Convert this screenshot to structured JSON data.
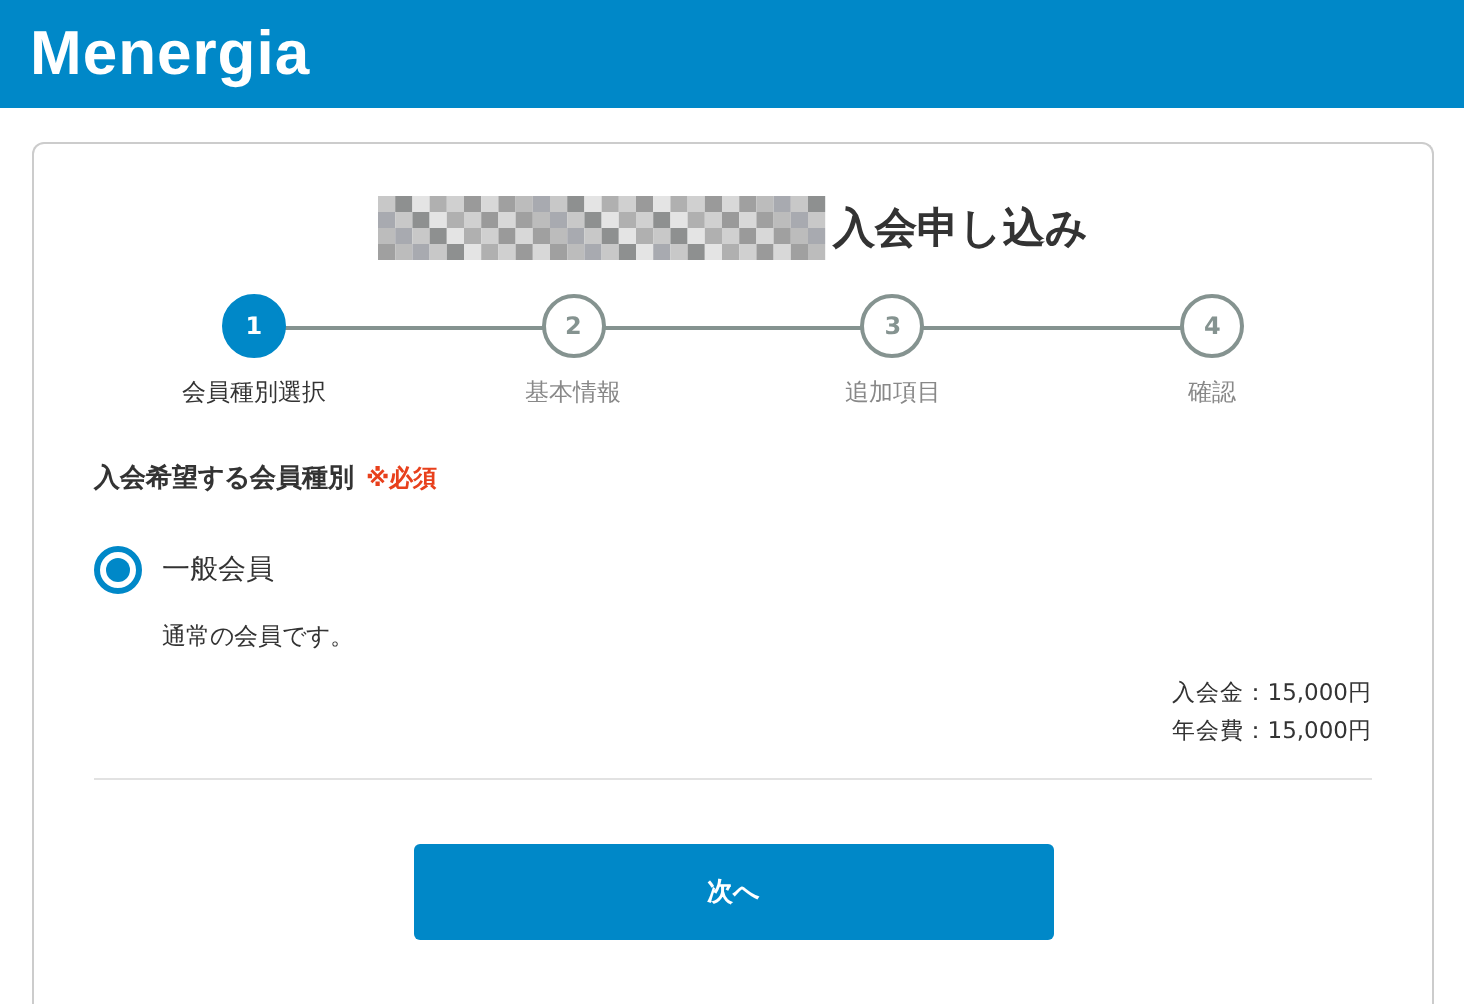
{
  "header": {
    "logo": "Menergia"
  },
  "page_title": "入会申し込み",
  "steps": [
    {
      "number": "1",
      "label": "会員種別選択",
      "selected": true
    },
    {
      "number": "2",
      "label": "基本情報",
      "selected": false
    },
    {
      "number": "3",
      "label": "追加項目",
      "selected": false
    },
    {
      "number": "4",
      "label": "確認",
      "selected": false
    }
  ],
  "field": {
    "label": "入会希望する会員種別",
    "required": "※必須"
  },
  "options": [
    {
      "label": "一般会員",
      "selected": true,
      "description": "通常の会員です。",
      "fees": [
        "入会金：15,000円",
        "年会費：15,000円"
      ]
    }
  ],
  "buttons": [
    "次へ"
  ]
}
